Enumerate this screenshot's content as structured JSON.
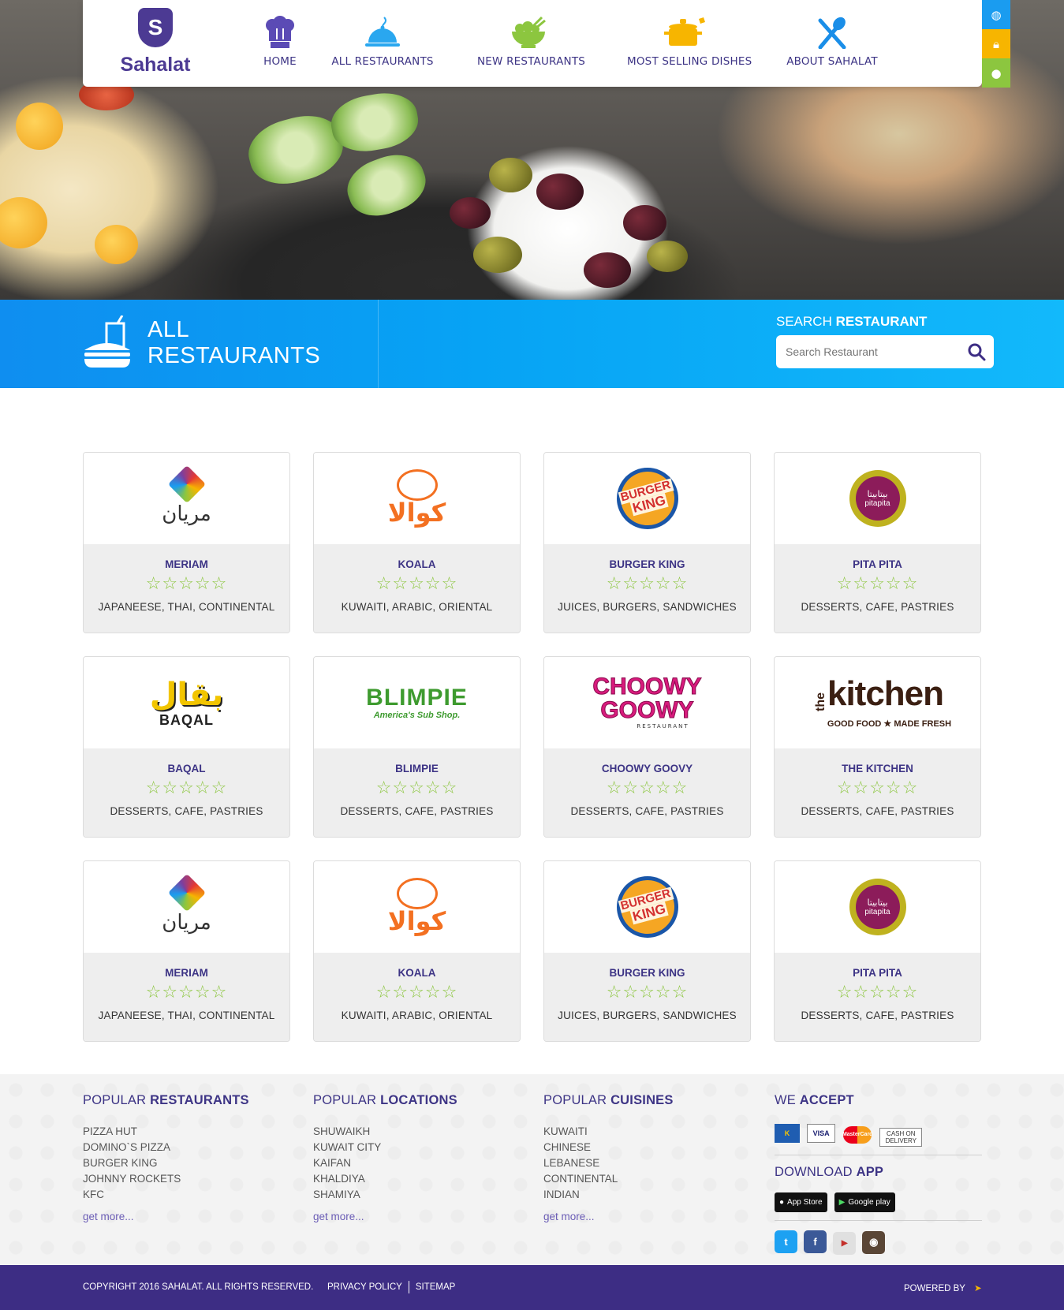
{
  "brand": {
    "name": "Sahalat",
    "shield_letter": "S"
  },
  "nav": [
    {
      "label": "HOME",
      "icon": "chef-hat-icon"
    },
    {
      "label": "ALL RESTAURANTS",
      "icon": "cloche-icon"
    },
    {
      "label": "NEW RESTAURANTS",
      "icon": "salad-bowl-icon"
    },
    {
      "label": "MOST SELLING DISHES",
      "icon": "cooking-pot-icon"
    },
    {
      "label": "ABOUT SAHALAT",
      "icon": "fork-spoon-icon"
    }
  ],
  "side_buttons": [
    {
      "icon": "globe-icon",
      "color": "#1a9cf0"
    },
    {
      "icon": "lock-icon",
      "color": "#f7b500"
    },
    {
      "icon": "user-icon",
      "color": "#8cc63f"
    }
  ],
  "page": {
    "title_line1": "ALL",
    "title_line2": "RESTAURANTS"
  },
  "search": {
    "label_light": "SEARCH",
    "label_bold": "RESTAURANT",
    "placeholder": "Search Restaurant"
  },
  "cards": [
    {
      "name": "MERIAM",
      "stars": "☆☆☆☆☆",
      "rating": 0,
      "cuisine": "JAPANEESE, THAI, CONTINENTAL",
      "logo": "meriam"
    },
    {
      "name": "KOALA",
      "stars": "☆☆☆☆☆",
      "rating": 0,
      "cuisine": "KUWAITI, ARABIC, ORIENTAL",
      "logo": "koala"
    },
    {
      "name": "BURGER KING",
      "stars": "☆☆☆☆☆",
      "rating": 0,
      "cuisine": "JUICES, BURGERS, SANDWICHES",
      "logo": "burgerking"
    },
    {
      "name": "PITA PITA",
      "stars": "☆☆☆☆☆",
      "rating": 0,
      "cuisine": "DESSERTS, CAFE, PASTRIES",
      "logo": "pitapita"
    },
    {
      "name": "BAQAL",
      "stars": "☆☆☆☆☆",
      "rating": 0,
      "cuisine": "DESSERTS, CAFE, PASTRIES",
      "logo": "baqal"
    },
    {
      "name": "BLIMPIE",
      "stars": "☆☆☆☆☆",
      "rating": 0,
      "cuisine": "DESSERTS, CAFE, PASTRIES",
      "logo": "blimpie"
    },
    {
      "name": "CHOOWY GOOVY",
      "stars": "☆☆☆☆☆",
      "rating": 0,
      "cuisine": "DESSERTS, CAFE, PASTRIES",
      "logo": "choowy"
    },
    {
      "name": "THE KITCHEN",
      "stars": "☆☆☆☆☆",
      "rating": 0,
      "cuisine": "DESSERTS, CAFE, PASTRIES",
      "logo": "kitchen"
    },
    {
      "name": "MERIAM",
      "stars": "☆☆☆☆☆",
      "rating": 0,
      "cuisine": "JAPANEESE, THAI, CONTINENTAL",
      "logo": "meriam"
    },
    {
      "name": "KOALA",
      "stars": "☆☆☆☆☆",
      "rating": 0,
      "cuisine": "KUWAITI, ARABIC, ORIENTAL",
      "logo": "koala"
    },
    {
      "name": "BURGER KING",
      "stars": "☆☆☆☆☆",
      "rating": 0,
      "cuisine": "JUICES, BURGERS, SANDWICHES",
      "logo": "burgerking"
    },
    {
      "name": "PITA PITA",
      "stars": "☆☆☆☆☆",
      "rating": 0,
      "cuisine": "DESSERTS, CAFE, PASTRIES",
      "logo": "pitapita"
    }
  ],
  "logos": {
    "meriam_text": "مريان",
    "koala_text": "كوالا",
    "bk_line1": "BURGER",
    "bk_line2": "KING",
    "pita_arabic": "بيتابيتا",
    "pita_latin": "pitapita",
    "baqal_arabic": "بقال",
    "baqal_latin": "BAQAL",
    "blimpie_main": "BLIMPIE",
    "blimpie_sub": "America's Sub Shop.",
    "choowy_line1": "CHOOWY",
    "choowy_line2": "GOOWY",
    "choowy_sub": "RESTAURANT",
    "kitchen_the": "the",
    "kitchen_main": "kitchen",
    "kitchen_sub": "GOOD FOOD ★ MADE FRESH"
  },
  "footer": {
    "restaurants": {
      "light": "POPULAR",
      "bold": "RESTAURANTS",
      "items": [
        "PIZZA HUT",
        "DOMINO`S PIZZA",
        "BURGER KING",
        "JOHNNY ROCKETS",
        "KFC"
      ],
      "more": "get more..."
    },
    "locations": {
      "light": "POPULAR",
      "bold": "LOCATIONS",
      "items": [
        "SHUWAIKH",
        "KUWAIT CITY",
        "KAIFAN",
        "KHALDIYA",
        "SHAMIYA"
      ],
      "more": "get more..."
    },
    "cuisines": {
      "light": "POPULAR",
      "bold": "CUISINES",
      "items": [
        "KUWAITI",
        "CHINESE",
        "LEBANESE",
        "CONTINENTAL",
        "INDIAN"
      ],
      "more": "get more..."
    },
    "accept": {
      "light": "WE",
      "bold": "ACCEPT",
      "cards": [
        "K",
        "VISA",
        "MasterCard",
        "CASH ON DELIVERY"
      ]
    },
    "app": {
      "light": "DOWNLOAD",
      "bold": "APP",
      "appstore": "App Store",
      "googleplay": "Google play"
    },
    "social": [
      "twitter-icon",
      "facebook-icon",
      "youtube-icon",
      "instagram-icon"
    ]
  },
  "bottom": {
    "copyright": "COPYRIGHT 2016 SAHALAT. ALL RIGHTS RESERVED.",
    "links": [
      "PRIVACY POLICY",
      "SITEMAP"
    ],
    "powered": "POWERED BY"
  }
}
